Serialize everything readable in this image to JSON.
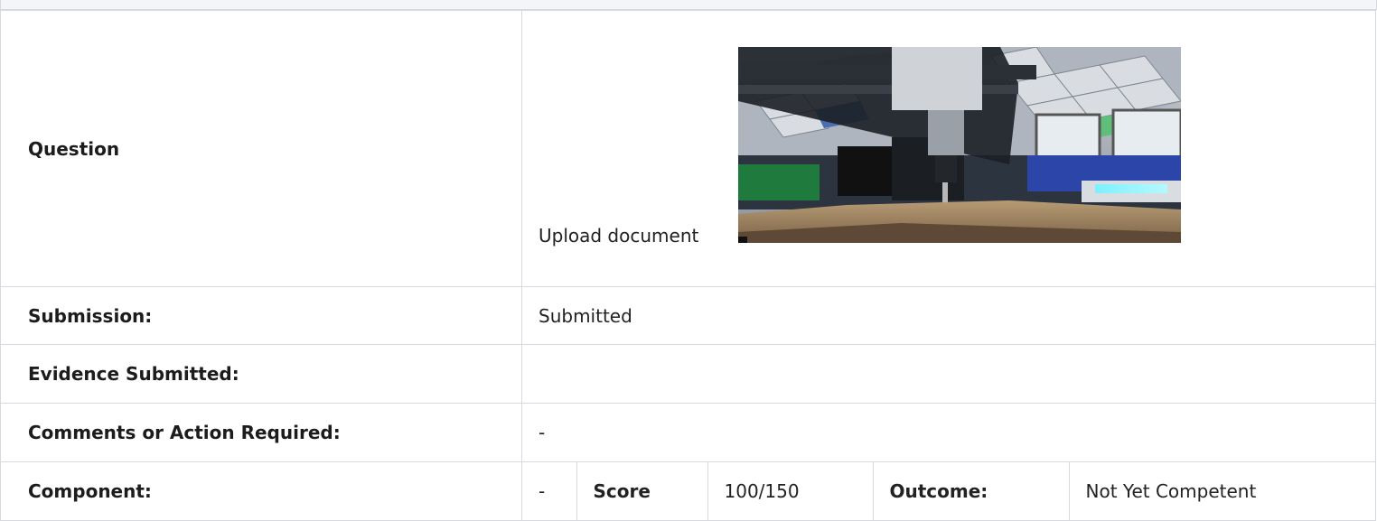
{
  "rows": {
    "question": {
      "label": "Question",
      "text": "Upload document",
      "image_alt": "CNC router milling a wooden board in a workshop"
    },
    "submission": {
      "label": "Submission:",
      "value": "Submitted"
    },
    "evidence": {
      "label": "Evidence Submitted:",
      "value": ""
    },
    "comments": {
      "label": "Comments or Action Required:",
      "value": "-"
    },
    "component": {
      "label": "Component:",
      "value": "-",
      "score_label": "Score",
      "score_value": "100/150",
      "outcome_label": "Outcome:",
      "outcome_value": "Not Yet Competent"
    }
  },
  "colors": {
    "border": "#d6d9df",
    "header_strip": "#f4f5f8",
    "text": "#222222"
  }
}
